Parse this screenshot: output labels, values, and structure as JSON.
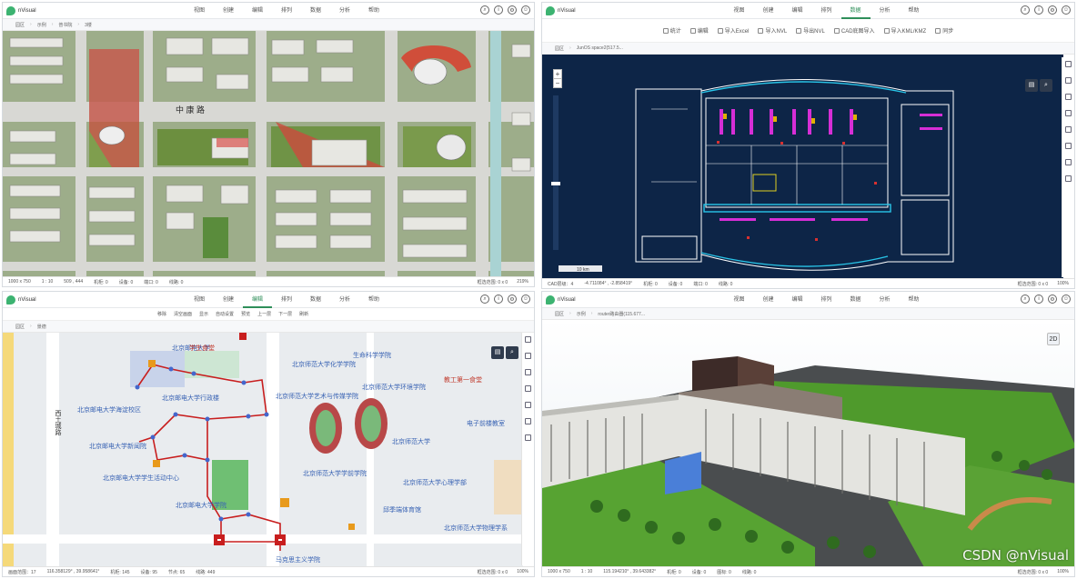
{
  "app": {
    "name": "nVisual"
  },
  "menu": [
    "视图",
    "创建",
    "编辑",
    "排列",
    "数据",
    "分析",
    "帮助"
  ],
  "panel1": {
    "active_menu": "",
    "breadcrumb": [
      "园区",
      "示例",
      "普书院",
      "3楼"
    ],
    "road_label": "中  康  路",
    "status": {
      "size": "1000 x 750",
      "scale": "1 : 10",
      "coord": "509 , 444",
      "cabinets": "机柜: 0",
      "devices": "设备: 0",
      "ports": "端口: 0",
      "cables": "线路: 0",
      "selection": "框选范围: 0 x 0",
      "zoom": "219%"
    }
  },
  "panel2": {
    "active_menu": "数据",
    "toolbar": [
      "统计",
      "编辑",
      "导入Excel",
      "导入NVL",
      "导出NVL",
      "CAD底图导入",
      "导入KML/KMZ",
      "同步"
    ],
    "breadcrumb": [
      "园区",
      "JunOS space2(517.5..."
    ],
    "scale_label": "10 km",
    "status": {
      "cad": "CAD层级：4",
      "coord": "-4.711084° , -2.858419°",
      "cabinets": "机柜: 0",
      "devices": "设备: 0",
      "ports": "端口: 0",
      "cables": "线路: 0",
      "selection": "框选范围: 0 x 0",
      "zoom": "100%"
    }
  },
  "panel3": {
    "active_menu": "编辑",
    "toolbar": [
      "移除",
      "清空画面",
      "显示",
      "自动设置",
      "预览",
      "上一层",
      "下一层",
      "刷新"
    ],
    "breadcrumb": [
      "园区",
      "景德"
    ],
    "labels": {
      "l1": "北京邮电大学",
      "l2": "学生食堂",
      "l3": "生命科学学院",
      "l4": "北京师范大学化学学院",
      "l5": "北京邮电大学海淀校区",
      "l6": "北京邮电大学行政楼",
      "l7": "北京师范大学艺术与传媒学院",
      "l8": "北京师范大学环境学院",
      "l9": "教工第一食堂",
      "l10": "电子前楼教室",
      "l11": "北京师范大学",
      "l12": "西土城路",
      "l13": "北京邮电大学新闻院",
      "l14": "北京邮电大学学生活动中心",
      "l15": "北京邮电大学学院",
      "l16": "北京师范大学心理学部",
      "l17": "北京师范大学学前学院",
      "l18": "马克思主义学院",
      "l19": "北京师范大学物理学系",
      "l20": "邱季端体育馆"
    },
    "status": {
      "size": "画面范围：17",
      "coord": "116.358129° , 39.958641°",
      "cabinets": "机柜: 145",
      "devices": "设备: 95",
      "ports": "节点: 65",
      "cables": "线路: 449",
      "selection": "框选范围: 0 x 0",
      "zoom": "100%"
    }
  },
  "panel4": {
    "active_menu": "",
    "breadcrumb": [
      "园区",
      "示例",
      "router路由器(115.677..."
    ],
    "view_btn": "2D",
    "status": {
      "size": "1000 x 750",
      "scale": "1 : 10",
      "coord": "115.194210° , 39.643382°",
      "cabinets": "机柜: 0",
      "devices": "设备: 0",
      "ports": "图标: 0",
      "cables": "线路: 0",
      "selection": "框选范围: 0 x 0",
      "zoom": "100%"
    }
  },
  "watermark": "CSDN @nVisual",
  "colors": {
    "brand": "#2f8f5a",
    "cad_bg": "#0d2547",
    "cad_line": "#ffffff",
    "cad_cyan": "#29c5e8",
    "cad_magenta": "#d62ed6",
    "route": "#c81e1e",
    "node": "#4466cc"
  }
}
